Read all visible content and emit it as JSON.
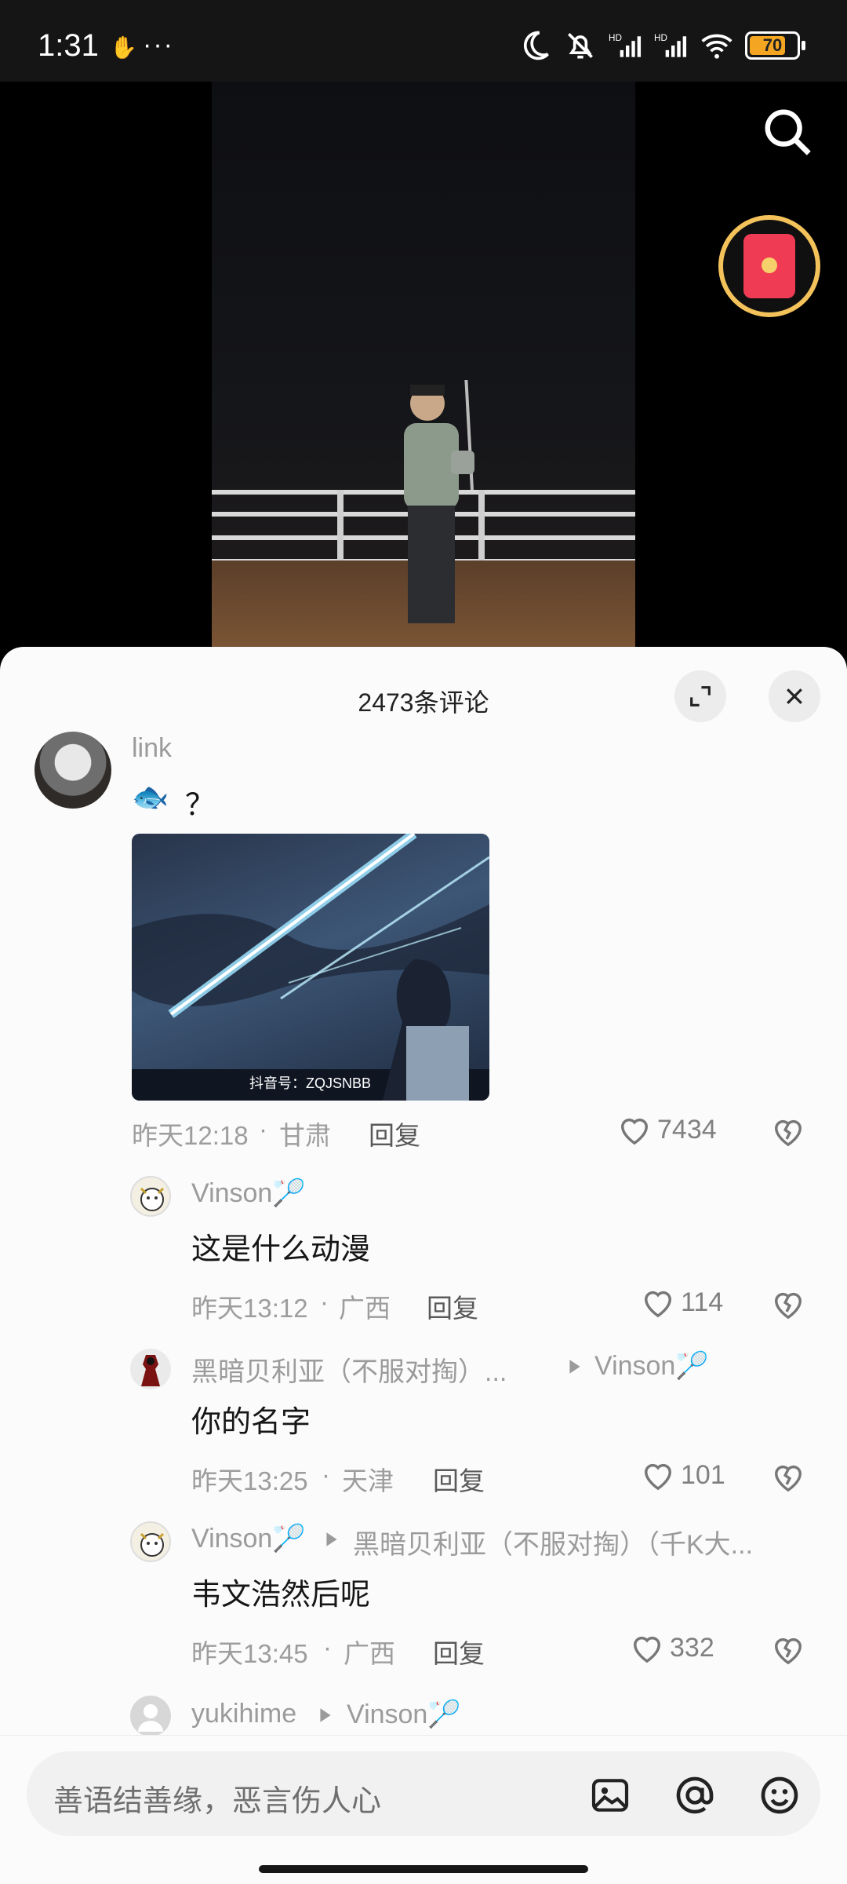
{
  "status_bar": {
    "time": "1:31",
    "hand_glyph": "✋",
    "dots": "···",
    "battery": "70",
    "icons": [
      "moon-icon",
      "bell-off-icon",
      "signal-hd-icon",
      "signal-hd-icon",
      "wifi-icon",
      "battery-icon"
    ]
  },
  "video": {
    "search_icon": "search-icon",
    "red_packet_icon": "red-envelope-icon"
  },
  "comments": {
    "title": "2473条评论",
    "expand_icon": "expand-icon",
    "close_icon": "close-icon",
    "items": [
      {
        "user": "link",
        "emoji": "🐟",
        "text": "？",
        "image_watermark": "抖音号：ZQJSNBB",
        "time": "昨天12:18",
        "sep": "·",
        "location": "甘肃",
        "reply": "回复",
        "likes": "7434"
      },
      {
        "user": "Vinson🏸",
        "text": "这是什么动漫",
        "time": "昨天13:12",
        "sep": "·",
        "location": "广西",
        "reply": "回复",
        "likes": "114"
      },
      {
        "user": "黑暗贝利亚（不服对掏）...",
        "reply_to": "Vinson🏸",
        "text": "你的名字",
        "time": "昨天13:25",
        "sep": "·",
        "location": "天津",
        "reply": "回复",
        "likes": "101"
      },
      {
        "user": "Vinson🏸",
        "reply_to": "黑暗贝利亚（不服对掏）（千K大...",
        "text": "韦文浩然后呢",
        "time": "昨天13:45",
        "sep": "·",
        "location": "广西",
        "reply": "回复",
        "likes": "332"
      },
      {
        "user": "yukihime",
        "reply_to": "Vinson🏸"
      }
    ]
  },
  "input": {
    "placeholder": "善语结善缘，恶言伤人心",
    "icons": [
      "image-icon",
      "at-icon",
      "emoji-icon"
    ]
  },
  "colors": {
    "accent_red": "#ef3b53",
    "ring_gold": "#f3c25b",
    "sheet_bg": "#fbfbfb"
  }
}
